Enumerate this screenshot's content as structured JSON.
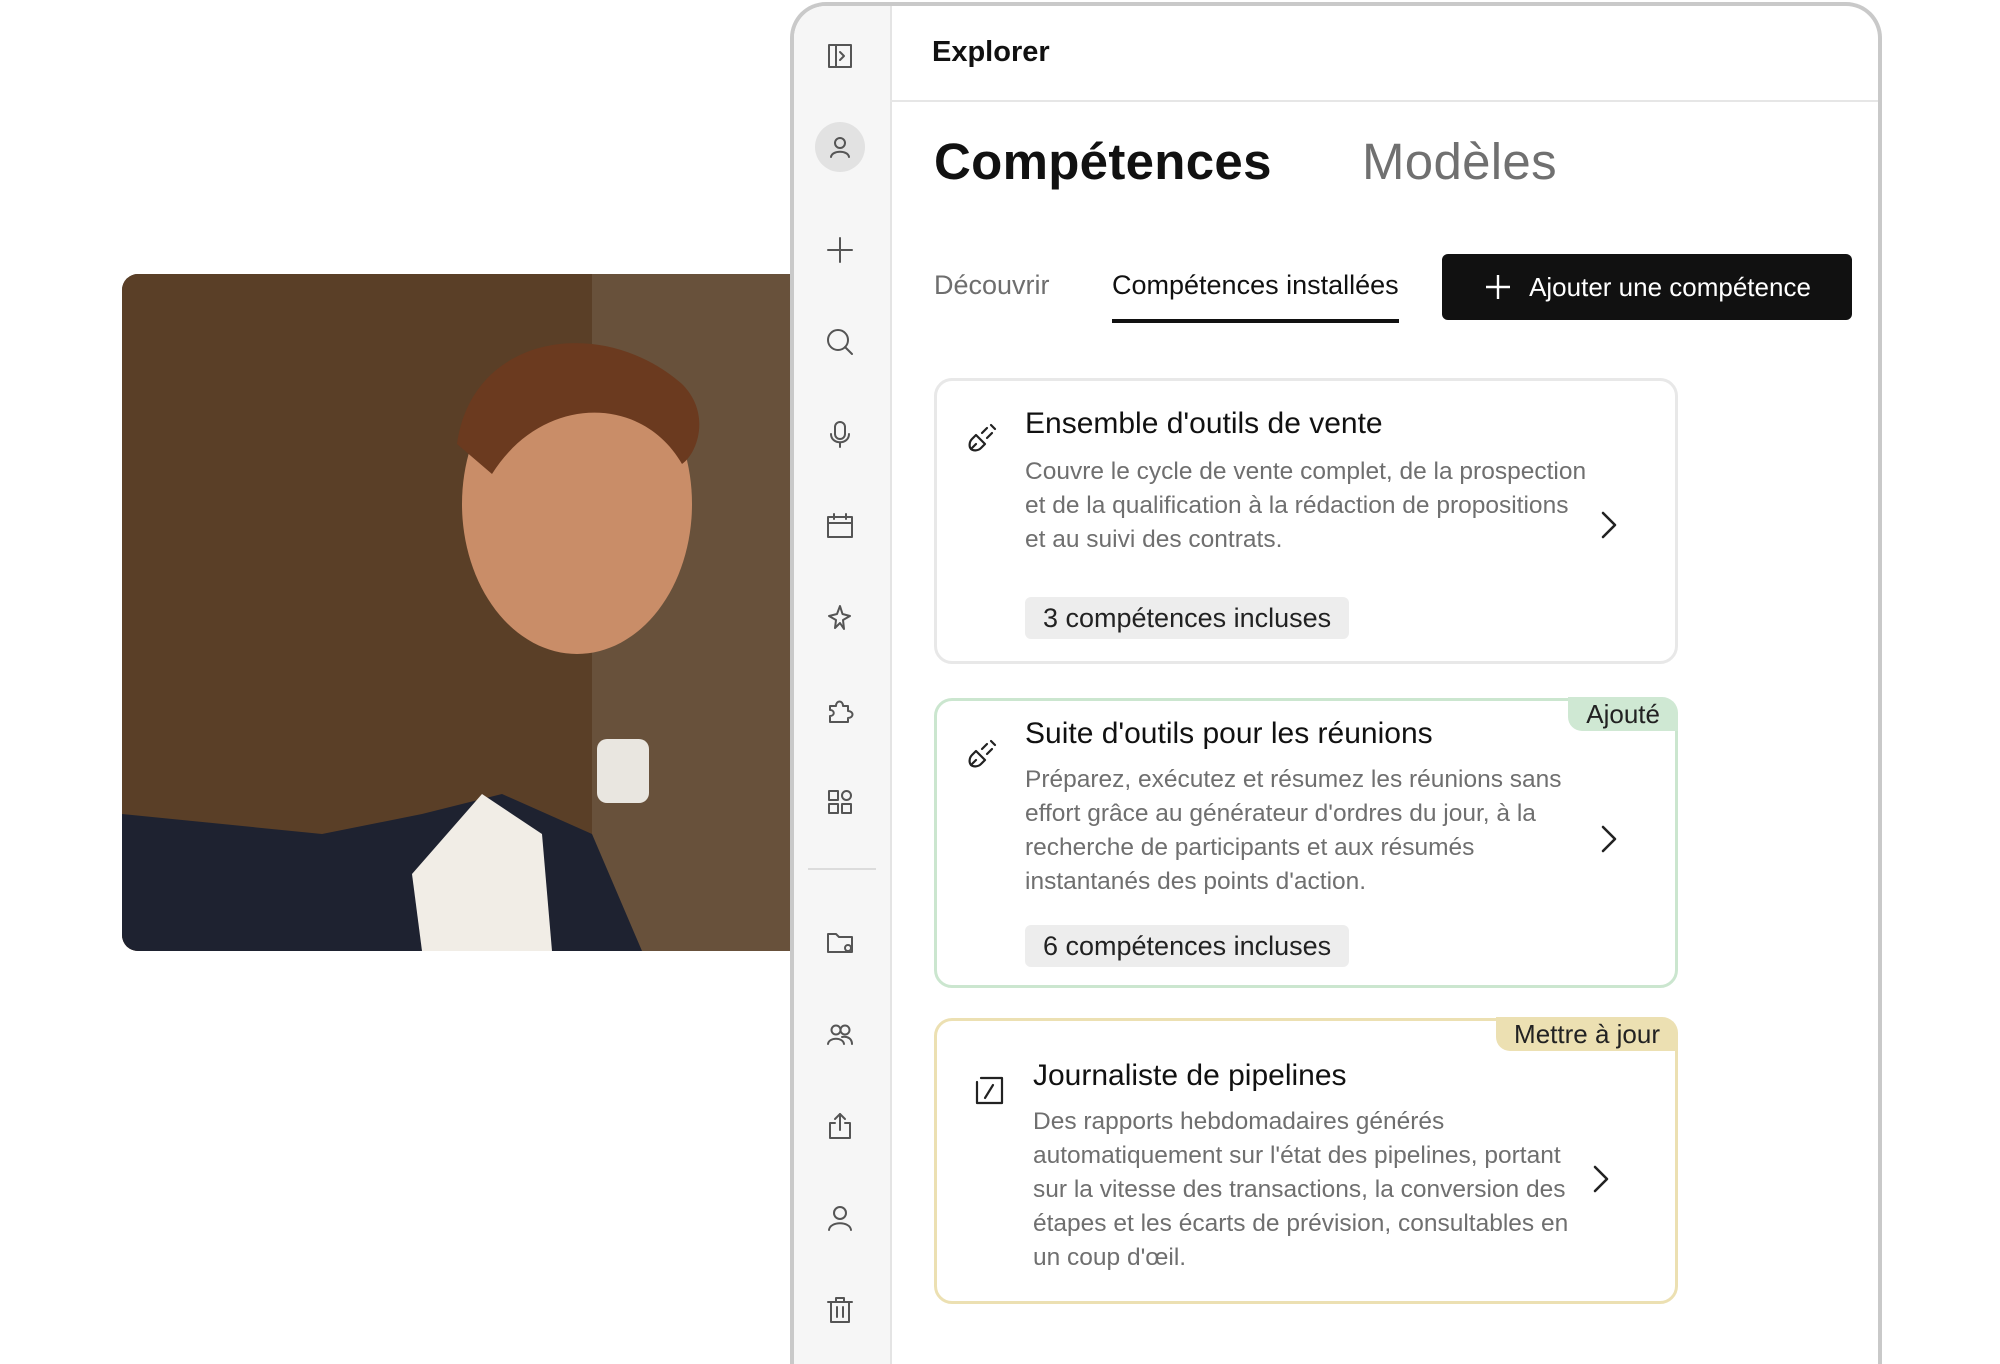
{
  "window": {
    "title": "Explorer"
  },
  "headings": {
    "active": "Compétences",
    "inactive": "Modèles"
  },
  "subtabs": {
    "discover": "Découvrir",
    "installed": "Compétences installées"
  },
  "add_button": {
    "label": "Ajouter une compétence",
    "icon": "plus-icon"
  },
  "rail_icons": [
    "sidebar-toggle-icon",
    "user-avatar-icon",
    "plus-icon",
    "search-icon",
    "microphone-icon",
    "calendar-icon",
    "sparkle-icon",
    "puzzle-icon",
    "apps-grid-icon",
    "folder-icon",
    "users-icon",
    "share-icon",
    "user-icon",
    "trash-icon"
  ],
  "cards": [
    {
      "icon": "plug-icon",
      "title": "Ensemble d'outils de vente",
      "description": "Couvre le cycle de vente complet, de la prospection et de la qualification à la rédaction de propositions et au suivi des contrats.",
      "pill": "3 compétences incluses"
    },
    {
      "icon": "plug-icon",
      "title": "Suite d'outils pour les réunions",
      "description": "Préparez, exécutez et résumez les réunions sans effort grâce au générateur d'ordres du jour, à la recherche de participants et aux résumés instantanés des points d'action.",
      "pill": "6 compétences incluses",
      "badge": "Ajouté"
    },
    {
      "icon": "slash-box-icon",
      "title": "Journaliste de pipelines",
      "description": "Des rapports hebdomadaires générés automatiquement sur l'état des pipelines, portant sur la vitesse des transactions, la conversion des étapes et les écarts de prévision, consultables en un coup d'œil.",
      "badge": "Mettre à jour"
    }
  ],
  "colors": {
    "accent": "#111111",
    "added_badge": "#cfe8d3",
    "update_badge": "#ece0b2"
  }
}
